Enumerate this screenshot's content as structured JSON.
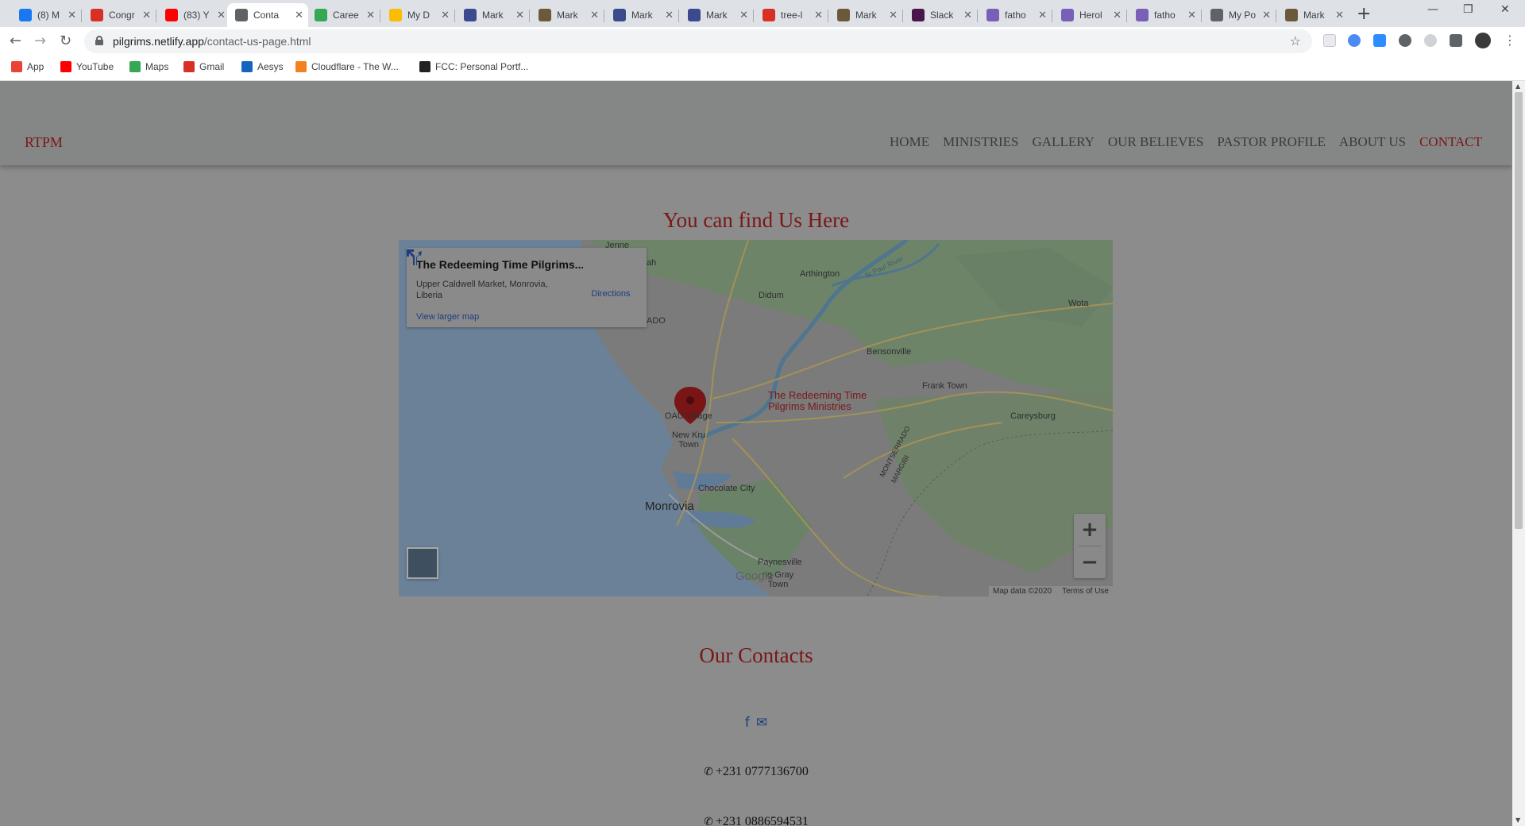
{
  "browser": {
    "tabs": [
      {
        "label": "(8) M",
        "icon": "facebook-icon",
        "color": "#1877f2"
      },
      {
        "label": "Congr",
        "icon": "gmail-icon",
        "color": "#d93025"
      },
      {
        "label": "(83) Y",
        "icon": "youtube-icon",
        "color": "#ff0000"
      },
      {
        "label": "Conta",
        "icon": "globe-icon",
        "color": "#5f6368"
      },
      {
        "label": "Caree",
        "icon": "careers-icon",
        "color": "#34a853"
      },
      {
        "label": "My D",
        "icon": "google-drive-icon",
        "color": "#fbbc04"
      },
      {
        "label": "Mark",
        "icon": "form-icon",
        "color": "#3b4a8c"
      },
      {
        "label": "Mark",
        "icon": "page-icon",
        "color": "#6b5a3a"
      },
      {
        "label": "Mark",
        "icon": "form-icon",
        "color": "#3b4a8c"
      },
      {
        "label": "Mark",
        "icon": "form-icon",
        "color": "#3b4a8c"
      },
      {
        "label": "tree-l",
        "icon": "pdf-icon",
        "color": "#d93025"
      },
      {
        "label": "Mark",
        "icon": "page-icon",
        "color": "#6b5a3a"
      },
      {
        "label": "Slack",
        "icon": "slack-icon",
        "color": "#4a154b"
      },
      {
        "label": "fatho",
        "icon": "heroku-icon",
        "color": "#7a5fb8"
      },
      {
        "label": "Herol",
        "icon": "heroku-icon",
        "color": "#7a5fb8"
      },
      {
        "label": "fatho",
        "icon": "heroku-icon",
        "color": "#7a5fb8"
      },
      {
        "label": "My Po",
        "icon": "globe-icon",
        "color": "#5f6368"
      },
      {
        "label": "Mark",
        "icon": "page-icon",
        "color": "#6b5a3a"
      }
    ],
    "url_host": "pilgrims.netlify.app",
    "url_path": "/contact-us-page.html",
    "bookmarks": [
      {
        "label": "App",
        "icon": "apps-grid-icon",
        "color": "#ea4335"
      },
      {
        "label": "YouTube",
        "icon": "youtube-icon",
        "color": "#ff0000"
      },
      {
        "label": "Maps",
        "icon": "maps-icon",
        "color": "#34a853"
      },
      {
        "label": "Gmail",
        "icon": "gmail-icon",
        "color": "#d93025"
      },
      {
        "label": "Aesys",
        "icon": "aesys-icon",
        "color": "#1565c0"
      },
      {
        "label": "Cloudflare - The W...",
        "icon": "cloudflare-icon",
        "color": "#f48120"
      },
      {
        "label": "FCC: Personal Portf...",
        "icon": "fcc-icon",
        "color": "#222222"
      }
    ]
  },
  "site": {
    "brand": "RTPM",
    "nav": [
      "HOME",
      "MINISTRIES",
      "GALLERY",
      "OUR BELIEVES",
      "PASTOR PROFILE",
      "ABOUT US",
      "CONTACT"
    ],
    "active_nav": "CONTACT",
    "accent_color": "#7a1717"
  },
  "map_section": {
    "title": "You can find Us Here",
    "infobox": {
      "title": "The Redeeming Time Pilgrims...",
      "address": "Upper Caldwell Market, Monrovia, Liberia",
      "directions": "Directions",
      "view_larger": "View larger map"
    },
    "place_labels": {
      "jenne": "Jenne",
      "arthington": "Arthington",
      "didum": "Didum",
      "wota": "Wota",
      "st_paul_river": "St Paul River",
      "bensonville": "Bensonville",
      "frank_town": "Frank Town",
      "oau_village": "OAU Village",
      "new_kru_town": "New Kru\nTown",
      "careysburg": "Careysburg",
      "chocolate_city": "Chocolate City",
      "monrovia": "Monrovia",
      "montserrado": "MONTSERRADO",
      "margibi": "MARGIBI",
      "paynesville": "Paynesville",
      "gray_town": "ng Gray\nTown",
      "edge_ah": "ah",
      "edge_ado": "ADO"
    },
    "pin_label": "The Redeeming Time\nPilgrims Ministries",
    "zoom_in": "+",
    "zoom_out": "−",
    "google": "Google",
    "map_data": "Map data ©2020",
    "terms": "Terms of Use"
  },
  "contacts": {
    "title": "Our Contacts",
    "social": [
      {
        "icon": "facebook-icon",
        "glyph": "f"
      },
      {
        "icon": "envelope-icon",
        "glyph": "✉"
      }
    ],
    "phones": [
      "+231 0777136700",
      "+231 0886594531"
    ]
  }
}
